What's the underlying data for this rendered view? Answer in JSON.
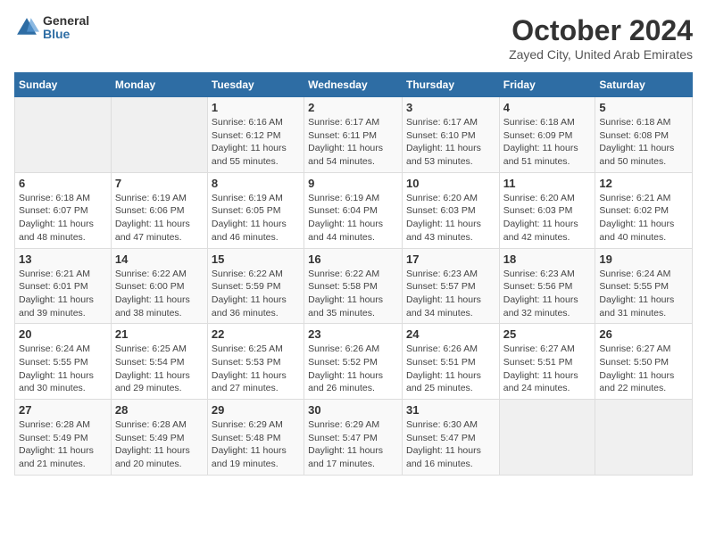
{
  "header": {
    "logo_general": "General",
    "logo_blue": "Blue",
    "month_title": "October 2024",
    "subtitle": "Zayed City, United Arab Emirates"
  },
  "days_of_week": [
    "Sunday",
    "Monday",
    "Tuesday",
    "Wednesday",
    "Thursday",
    "Friday",
    "Saturday"
  ],
  "weeks": [
    [
      {
        "day": "",
        "content": ""
      },
      {
        "day": "",
        "content": ""
      },
      {
        "day": "1",
        "content": "Sunrise: 6:16 AM\nSunset: 6:12 PM\nDaylight: 11 hours and 55 minutes."
      },
      {
        "day": "2",
        "content": "Sunrise: 6:17 AM\nSunset: 6:11 PM\nDaylight: 11 hours and 54 minutes."
      },
      {
        "day": "3",
        "content": "Sunrise: 6:17 AM\nSunset: 6:10 PM\nDaylight: 11 hours and 53 minutes."
      },
      {
        "day": "4",
        "content": "Sunrise: 6:18 AM\nSunset: 6:09 PM\nDaylight: 11 hours and 51 minutes."
      },
      {
        "day": "5",
        "content": "Sunrise: 6:18 AM\nSunset: 6:08 PM\nDaylight: 11 hours and 50 minutes."
      }
    ],
    [
      {
        "day": "6",
        "content": "Sunrise: 6:18 AM\nSunset: 6:07 PM\nDaylight: 11 hours and 48 minutes."
      },
      {
        "day": "7",
        "content": "Sunrise: 6:19 AM\nSunset: 6:06 PM\nDaylight: 11 hours and 47 minutes."
      },
      {
        "day": "8",
        "content": "Sunrise: 6:19 AM\nSunset: 6:05 PM\nDaylight: 11 hours and 46 minutes."
      },
      {
        "day": "9",
        "content": "Sunrise: 6:19 AM\nSunset: 6:04 PM\nDaylight: 11 hours and 44 minutes."
      },
      {
        "day": "10",
        "content": "Sunrise: 6:20 AM\nSunset: 6:03 PM\nDaylight: 11 hours and 43 minutes."
      },
      {
        "day": "11",
        "content": "Sunrise: 6:20 AM\nSunset: 6:03 PM\nDaylight: 11 hours and 42 minutes."
      },
      {
        "day": "12",
        "content": "Sunrise: 6:21 AM\nSunset: 6:02 PM\nDaylight: 11 hours and 40 minutes."
      }
    ],
    [
      {
        "day": "13",
        "content": "Sunrise: 6:21 AM\nSunset: 6:01 PM\nDaylight: 11 hours and 39 minutes."
      },
      {
        "day": "14",
        "content": "Sunrise: 6:22 AM\nSunset: 6:00 PM\nDaylight: 11 hours and 38 minutes."
      },
      {
        "day": "15",
        "content": "Sunrise: 6:22 AM\nSunset: 5:59 PM\nDaylight: 11 hours and 36 minutes."
      },
      {
        "day": "16",
        "content": "Sunrise: 6:22 AM\nSunset: 5:58 PM\nDaylight: 11 hours and 35 minutes."
      },
      {
        "day": "17",
        "content": "Sunrise: 6:23 AM\nSunset: 5:57 PM\nDaylight: 11 hours and 34 minutes."
      },
      {
        "day": "18",
        "content": "Sunrise: 6:23 AM\nSunset: 5:56 PM\nDaylight: 11 hours and 32 minutes."
      },
      {
        "day": "19",
        "content": "Sunrise: 6:24 AM\nSunset: 5:55 PM\nDaylight: 11 hours and 31 minutes."
      }
    ],
    [
      {
        "day": "20",
        "content": "Sunrise: 6:24 AM\nSunset: 5:55 PM\nDaylight: 11 hours and 30 minutes."
      },
      {
        "day": "21",
        "content": "Sunrise: 6:25 AM\nSunset: 5:54 PM\nDaylight: 11 hours and 29 minutes."
      },
      {
        "day": "22",
        "content": "Sunrise: 6:25 AM\nSunset: 5:53 PM\nDaylight: 11 hours and 27 minutes."
      },
      {
        "day": "23",
        "content": "Sunrise: 6:26 AM\nSunset: 5:52 PM\nDaylight: 11 hours and 26 minutes."
      },
      {
        "day": "24",
        "content": "Sunrise: 6:26 AM\nSunset: 5:51 PM\nDaylight: 11 hours and 25 minutes."
      },
      {
        "day": "25",
        "content": "Sunrise: 6:27 AM\nSunset: 5:51 PM\nDaylight: 11 hours and 24 minutes."
      },
      {
        "day": "26",
        "content": "Sunrise: 6:27 AM\nSunset: 5:50 PM\nDaylight: 11 hours and 22 minutes."
      }
    ],
    [
      {
        "day": "27",
        "content": "Sunrise: 6:28 AM\nSunset: 5:49 PM\nDaylight: 11 hours and 21 minutes."
      },
      {
        "day": "28",
        "content": "Sunrise: 6:28 AM\nSunset: 5:49 PM\nDaylight: 11 hours and 20 minutes."
      },
      {
        "day": "29",
        "content": "Sunrise: 6:29 AM\nSunset: 5:48 PM\nDaylight: 11 hours and 19 minutes."
      },
      {
        "day": "30",
        "content": "Sunrise: 6:29 AM\nSunset: 5:47 PM\nDaylight: 11 hours and 17 minutes."
      },
      {
        "day": "31",
        "content": "Sunrise: 6:30 AM\nSunset: 5:47 PM\nDaylight: 11 hours and 16 minutes."
      },
      {
        "day": "",
        "content": ""
      },
      {
        "day": "",
        "content": ""
      }
    ]
  ]
}
